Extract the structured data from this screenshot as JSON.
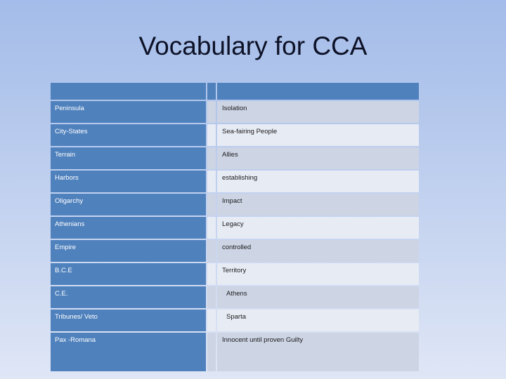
{
  "slide": {
    "title": "Vocabulary for CCA",
    "title_color": "#0d1126",
    "background_top_color": "#a4bce9",
    "background_bottom_color": "#dfe6f6"
  },
  "table": {
    "accent_color": "#4f81bd",
    "row_shade_dark": "#cdd4e4",
    "row_shade_light": "#e7ebf4",
    "header": {
      "term_label": "",
      "gap_label": "",
      "definition_label": ""
    },
    "rows": [
      {
        "term": "Peninsula",
        "definition": "Isolation"
      },
      {
        "term": "City-States",
        "definition": "Sea-fairing People"
      },
      {
        "term": "Terrain",
        "definition": "Allies"
      },
      {
        "term": "Harbors",
        "definition": "establishing"
      },
      {
        "term": "Oligarchy",
        "definition": "Impact"
      },
      {
        "term": "Athenians",
        "definition": "Legacy"
      },
      {
        "term": "Empire",
        "definition": "controlled"
      },
      {
        "term": "B.C.E",
        "definition": "Territory"
      },
      {
        "term": "C.E.",
        "definition": "Athens"
      },
      {
        "term": "Tribunes/ Veto",
        "definition": "Sparta"
      },
      {
        "term": "Pax -Romana",
        "definition": "Innocent until proven Guilty"
      }
    ]
  }
}
